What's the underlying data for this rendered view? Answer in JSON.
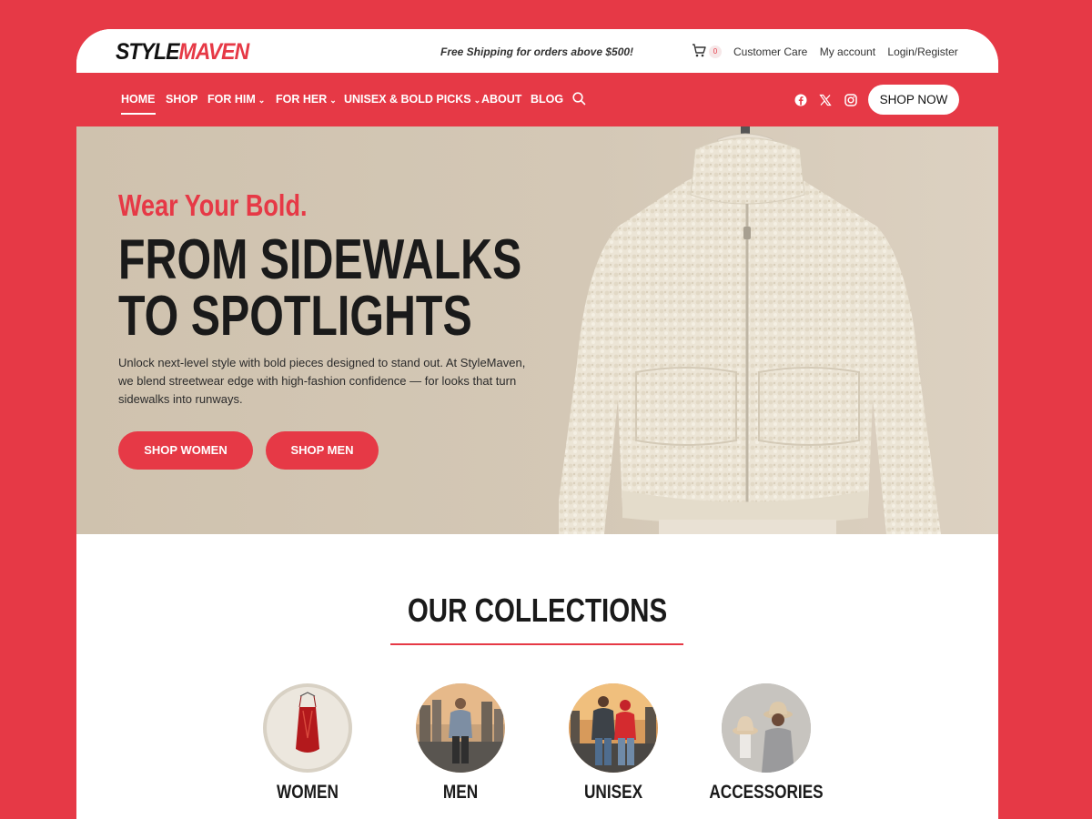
{
  "brand": {
    "part1": "STYLE",
    "part2": "MAVEN"
  },
  "topbar": {
    "shipping": "Free Shipping for orders above $500!",
    "cart_count": "0",
    "links": [
      "Customer Care",
      "My account",
      "Login/Register"
    ]
  },
  "nav": {
    "items": [
      {
        "label": "HOME",
        "dropdown": false,
        "active": true
      },
      {
        "label": "SHOP",
        "dropdown": false
      },
      {
        "label": "FOR HIM",
        "dropdown": true
      },
      {
        "label": "FOR HER",
        "dropdown": true
      },
      {
        "label": "UNISEX & BOLD PICKS",
        "dropdown": true
      },
      {
        "label": "ABOUT",
        "dropdown": false
      },
      {
        "label": "BLOG",
        "dropdown": false
      }
    ],
    "cta": "SHOP NOW",
    "social": [
      "facebook-icon",
      "x-icon",
      "instagram-icon"
    ]
  },
  "hero": {
    "tagline": "Wear Your Bold.",
    "title_line1": "FROM SIDEWALKS",
    "title_line2": "TO SPOTLIGHTS",
    "description": "Unlock next-level style with bold pieces designed to stand out. At StyleMaven, we blend streetwear edge with high-fashion confidence — for looks that turn sidewalks into runways.",
    "btn_women": "SHOP WOMEN",
    "btn_men": "SHOP MEN"
  },
  "collections": {
    "title": "OUR COLLECTIONS",
    "items": [
      "WOMEN",
      "MEN",
      "UNISEX",
      "ACCESSORIES"
    ]
  },
  "colors": {
    "accent": "#e63946",
    "hero_bg": "#d3c7b5",
    "text_dark": "#1a1a1a"
  }
}
